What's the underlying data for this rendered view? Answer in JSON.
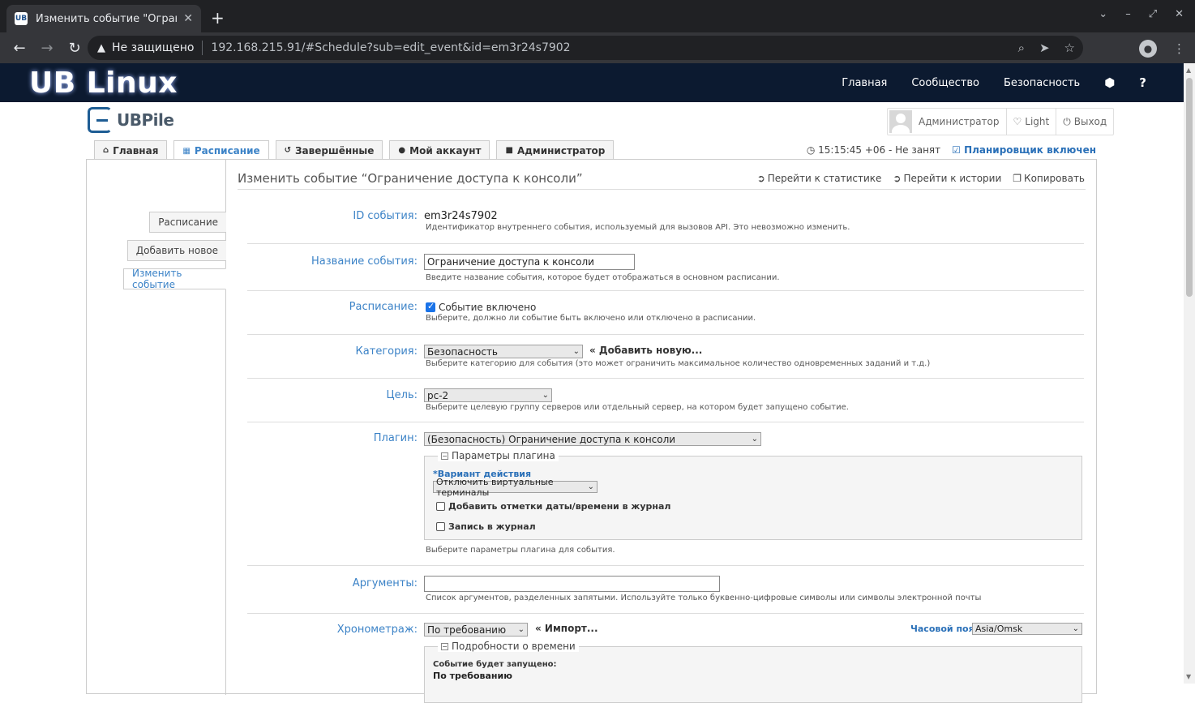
{
  "browser": {
    "tab_title": "Изменить событие \"Огранич",
    "tab_favicon": "UB",
    "not_secure": "Не защищено",
    "url": "192.168.215.91/#Schedule?sub=edit_event&id=em3r24s7902"
  },
  "site": {
    "brand": "UB Linux",
    "nav": [
      "Главная",
      "Сообщество",
      "Безопасность"
    ]
  },
  "app": {
    "name": "UBPile",
    "user": "Администратор",
    "theme": "Light",
    "logout": "Выход",
    "tabs": [
      "Главная",
      "Расписание",
      "Завершённые",
      "Мой аккаунт",
      "Администратор"
    ],
    "status_time": "15:15:45 +06 - Не занят",
    "status_scheduler": "Планировщик включен"
  },
  "side_nav": [
    "Расписание",
    "Добавить новое",
    "Изменить событие"
  ],
  "page": {
    "title": "Изменить событие “Ограничение доступа к консоли”",
    "actions": [
      "Перейти к статистике",
      "Перейти к истории",
      "Копировать"
    ]
  },
  "form": {
    "event_id": {
      "label": "ID события:",
      "value": "em3r24s7902",
      "caption": "Идентификатор внутреннего события, используемый для вызовов API. Это невозможно изменить."
    },
    "event_name": {
      "label": "Название события:",
      "value": "Ограничение доступа к консоли",
      "caption": "Введите название события, которое будет отображаться в основном расписании."
    },
    "schedule": {
      "label": "Расписание:",
      "checkbox": "Событие включено",
      "caption": "Выберите, должно ли событие быть включено или отключено в расписании."
    },
    "category": {
      "label": "Категория:",
      "value": "Безопасность",
      "add_new": "« Добавить новую...",
      "caption": "Выберите категорию для события (это может ограничить максимальное количество одновременных заданий и т.д.)"
    },
    "target": {
      "label": "Цель:",
      "value": "pc-2",
      "caption": "Выберите целевую группу серверов или отдельный сервер, на котором будет запущено событие."
    },
    "plugin": {
      "label": "Плагин:",
      "value": "(Безопасность) Ограничение доступа к консоли",
      "params_legend": "Параметры плагина",
      "action_label": "*Вариант действия",
      "action_value": "Отключить виртуальные терминалы",
      "chk_timestamps": "Добавить отметки даты/времени в журнал",
      "chk_log": "Запись в журнал",
      "caption": "Выберите параметры плагина для события."
    },
    "arguments": {
      "label": "Аргументы:",
      "value": "",
      "caption": "Список аргументов, разделенных запятыми. Используйте только буквенно-цифровые символы или символы электронной почты"
    },
    "timing": {
      "label": "Хронометраж:",
      "value": "По требованию",
      "import": "« Импорт...",
      "tz_label": "Часовой пояс:",
      "tz_value": "Asia/Omsk",
      "details_legend": "Подробности о времени",
      "details_line1": "Событие будет запущено:",
      "details_line2": "По требованию"
    }
  }
}
